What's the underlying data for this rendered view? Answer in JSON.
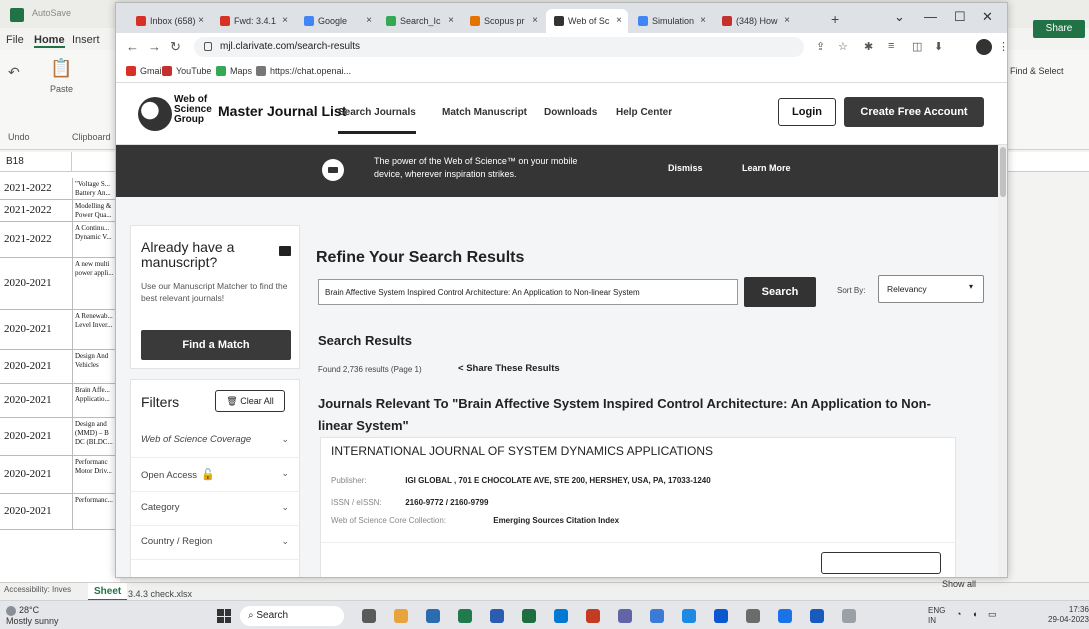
{
  "excel": {
    "menu": [
      "File",
      "Home",
      "Insert"
    ],
    "paste_label": "Paste",
    "undo_label": "Undo",
    "clipboard_label": "Clipboard",
    "name_box": "B18",
    "find_select": "Find & Select",
    "share_label": "Share",
    "sheet_tab": "Sheet",
    "show_all": "Show all",
    "accessibility": "Accessibility: Inves",
    "download": "3.4.3 check.xlsx",
    "rows": [
      {
        "year": "2021-2022",
        "title": "\"Voltage S... Battery An..."
      },
      {
        "year": "2021-2022",
        "title": "Modelling & Power Qua..."
      },
      {
        "year": "2021-2022",
        "title": "A Continu... Dynamic V..."
      },
      {
        "year": "2020-2021",
        "title": "A new multi power appli..."
      },
      {
        "year": "2020-2021",
        "title": "A Renewab... Level Inver..."
      },
      {
        "year": "2020-2021",
        "title": "Design And Vehicles"
      },
      {
        "year": "2020-2021",
        "title": "Brain Affe... Applicatio..."
      },
      {
        "year": "2020-2021",
        "title": "Design and (MMD) – B DC (BLDC..."
      },
      {
        "year": "2020-2021",
        "title": "Performanc Motor Driv..."
      },
      {
        "year": "2020-2021",
        "title": "Performanc..."
      }
    ]
  },
  "browser": {
    "tabs": [
      {
        "label": "Inbox (658)",
        "color": "#d93025"
      },
      {
        "label": "Fwd: 3.4.1",
        "color": "#d93025"
      },
      {
        "label": "Google",
        "color": "#4285f4"
      },
      {
        "label": "Search_Ic",
        "color": "#34a853"
      },
      {
        "label": "Scopus pr",
        "color": "#e37400"
      },
      {
        "label": "Web of Sc",
        "color": "#333333"
      },
      {
        "label": "Simulation",
        "color": "#4285f4"
      },
      {
        "label": "(348) How",
        "color": "#c4302b"
      }
    ],
    "url": "mjl.clarivate.com/search-results",
    "bookmarks": [
      {
        "label": "Gmail",
        "color": "#d93025"
      },
      {
        "label": "YouTube",
        "color": "#c4302b"
      },
      {
        "label": "Maps",
        "color": "#34a853"
      },
      {
        "label": "https://chat.openai...",
        "color": "#777777"
      }
    ]
  },
  "site": {
    "logo_text": "Web of Science Group",
    "title": "Master Journal List",
    "nav": [
      "Search Journals",
      "Match Manuscript",
      "Downloads",
      "Help Center"
    ],
    "login": "Login",
    "create_account": "Create Free Account",
    "banner": {
      "text": "The power of the Web of Science™ on your mobile device, wherever inspiration strikes.",
      "dismiss": "Dismiss",
      "learn_more": "Learn More"
    }
  },
  "sidebar": {
    "heading": "Already have a manuscript?",
    "description": "Use our Manuscript Matcher to find the best relevant journals!",
    "find_match": "Find a Match",
    "filters_title": "Filters",
    "clear_all": "Clear All",
    "filters": [
      "Web of Science Coverage",
      "Open Access",
      "Category",
      "Country / Region"
    ]
  },
  "main": {
    "refine_title": "Refine Your Search Results",
    "search_value": "Brain Affective System Inspired Control Architecture: An Application to Non-linear System",
    "search_button": "Search",
    "sort_by_label": "Sort By:",
    "sort_by_value": "Relevancy",
    "results_title": "Search Results",
    "found": "Found 2,736 results (Page 1)",
    "share": "Share These Results",
    "relevant_title": "Journals Relevant To \"Brain Affective System Inspired Control Architecture: An Application to Non-linear System\"",
    "journal": {
      "name": "INTERNATIONAL JOURNAL OF SYSTEM DYNAMICS APPLICATIONS",
      "publisher_label": "Publisher:",
      "publisher": "IGI GLOBAL , 701 E CHOCOLATE AVE, STE 200, HERSHEY, USA, PA, 17033-1240",
      "issn_label": "ISSN / eISSN:",
      "issn": "2160-9772 / 2160-9799",
      "collection_label": "Web of Science Core Collection:",
      "collection": "Emerging Sources Citation Index"
    }
  },
  "taskbar": {
    "weather_temp": "28°C",
    "weather_desc": "Mostly sunny",
    "search": "Search",
    "lang": "ENG",
    "region": "IN",
    "time": "17:36",
    "date": "29-04-2023",
    "apps": [
      "#5a5a5a",
      "#e8a33d",
      "#2b6cb0",
      "#1f7a4d",
      "#2a5db0",
      "#1d6f42",
      "#0078d4",
      "#c23b22",
      "#6264a7",
      "#3a7bd5",
      "#1e88e5",
      "#0b57d0",
      "#6b6b6b",
      "#1a73e8",
      "#185abd",
      "#9aa0a6"
    ]
  }
}
